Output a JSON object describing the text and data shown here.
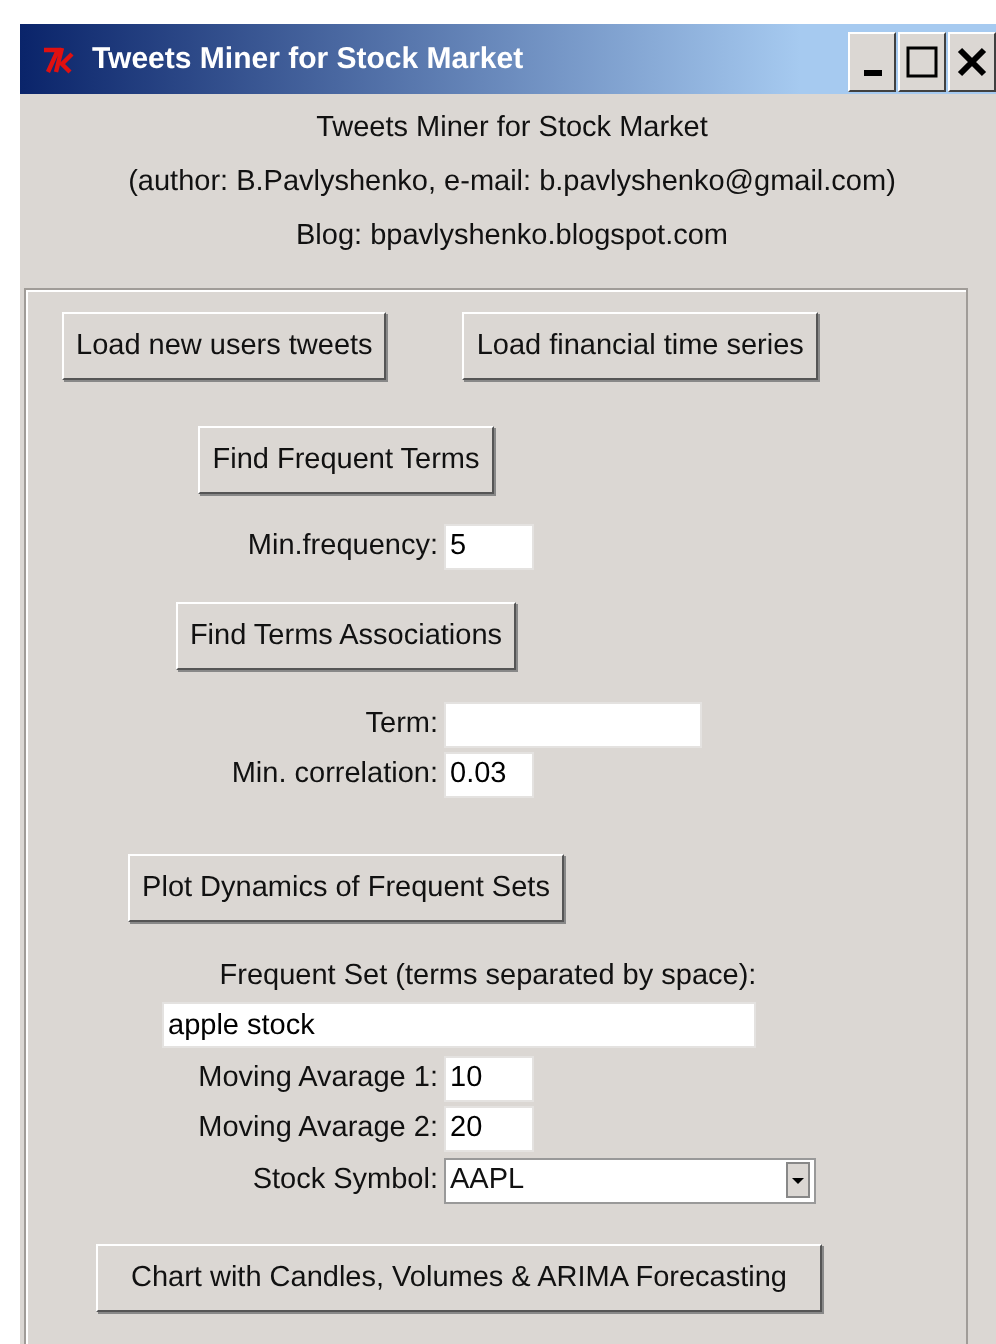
{
  "window": {
    "title": "Tweets Miner for Stock Market"
  },
  "header": [
    "Tweets Miner for Stock Market",
    "(author: B.Pavlyshenko, e-mail: b.pavlyshenko@gmail.com)",
    "Blog: bpavlyshenko.blogspot.com"
  ],
  "load_buttons": [
    "Load new users tweets",
    "Load financial time series"
  ],
  "frequent_terms": {
    "button": "Find Frequent Terms",
    "fields": [
      {
        "label": "Min.frequency:",
        "value": "5",
        "kind": "short"
      }
    ]
  },
  "associations": {
    "button": "Find Terms Associations",
    "fields": [
      {
        "label": "Term:",
        "kind": "long"
      },
      {
        "label": "Min. correlation:",
        "value": "0.03",
        "kind": "short"
      }
    ]
  },
  "dynamics": {
    "button": "Plot Dynamics of Frequent Sets",
    "set_label": "Frequent Set (terms separated by space):",
    "set_value": "apple stock",
    "fields": [
      {
        "label": "Moving Avarage 1:",
        "value": "10",
        "kind": "short"
      },
      {
        "label": "Moving Avarage 2:",
        "value": "20",
        "kind": "short"
      },
      {
        "label": "Stock Symbol:",
        "value": "AAPL",
        "kind": "combo"
      }
    ]
  },
  "chart_button": "Chart with Candles, Volumes & ARIMA Forecasting"
}
